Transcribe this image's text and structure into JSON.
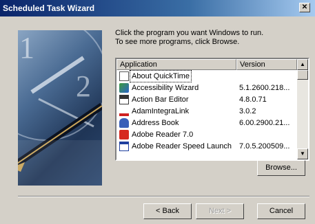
{
  "window": {
    "title": "Scheduled Task Wizard",
    "close_glyph": "✕"
  },
  "instructions": {
    "line1": "Click the program you want Windows to run.",
    "line2": "To see more programs, click Browse."
  },
  "list": {
    "columns": [
      "Application",
      "Version"
    ],
    "rows": [
      {
        "app": "About QuickTime",
        "version": "",
        "icon": "quicktime-doc-icon",
        "focused": true
      },
      {
        "app": "Accessibility Wizard",
        "version": "5.1.2600.218...",
        "icon": "accessibility-icon"
      },
      {
        "app": "Action Bar Editor",
        "version": "4.8.0.71",
        "icon": "action-bar-icon"
      },
      {
        "app": "AdamIntegraLink",
        "version": "3.0.2",
        "icon": "adam-icon"
      },
      {
        "app": "Address Book",
        "version": "6.00.2900.21...",
        "icon": "address-book-icon"
      },
      {
        "app": "Adobe Reader 7.0",
        "version": "",
        "icon": "adobe-reader-icon"
      },
      {
        "app": "Adobe Reader Speed Launch",
        "version": "7.0.5.200509...",
        "icon": "adobe-speed-launch-icon"
      }
    ]
  },
  "buttons": {
    "browse": "Browse...",
    "back": "< Back",
    "next": "Next >",
    "cancel": "Cancel"
  }
}
